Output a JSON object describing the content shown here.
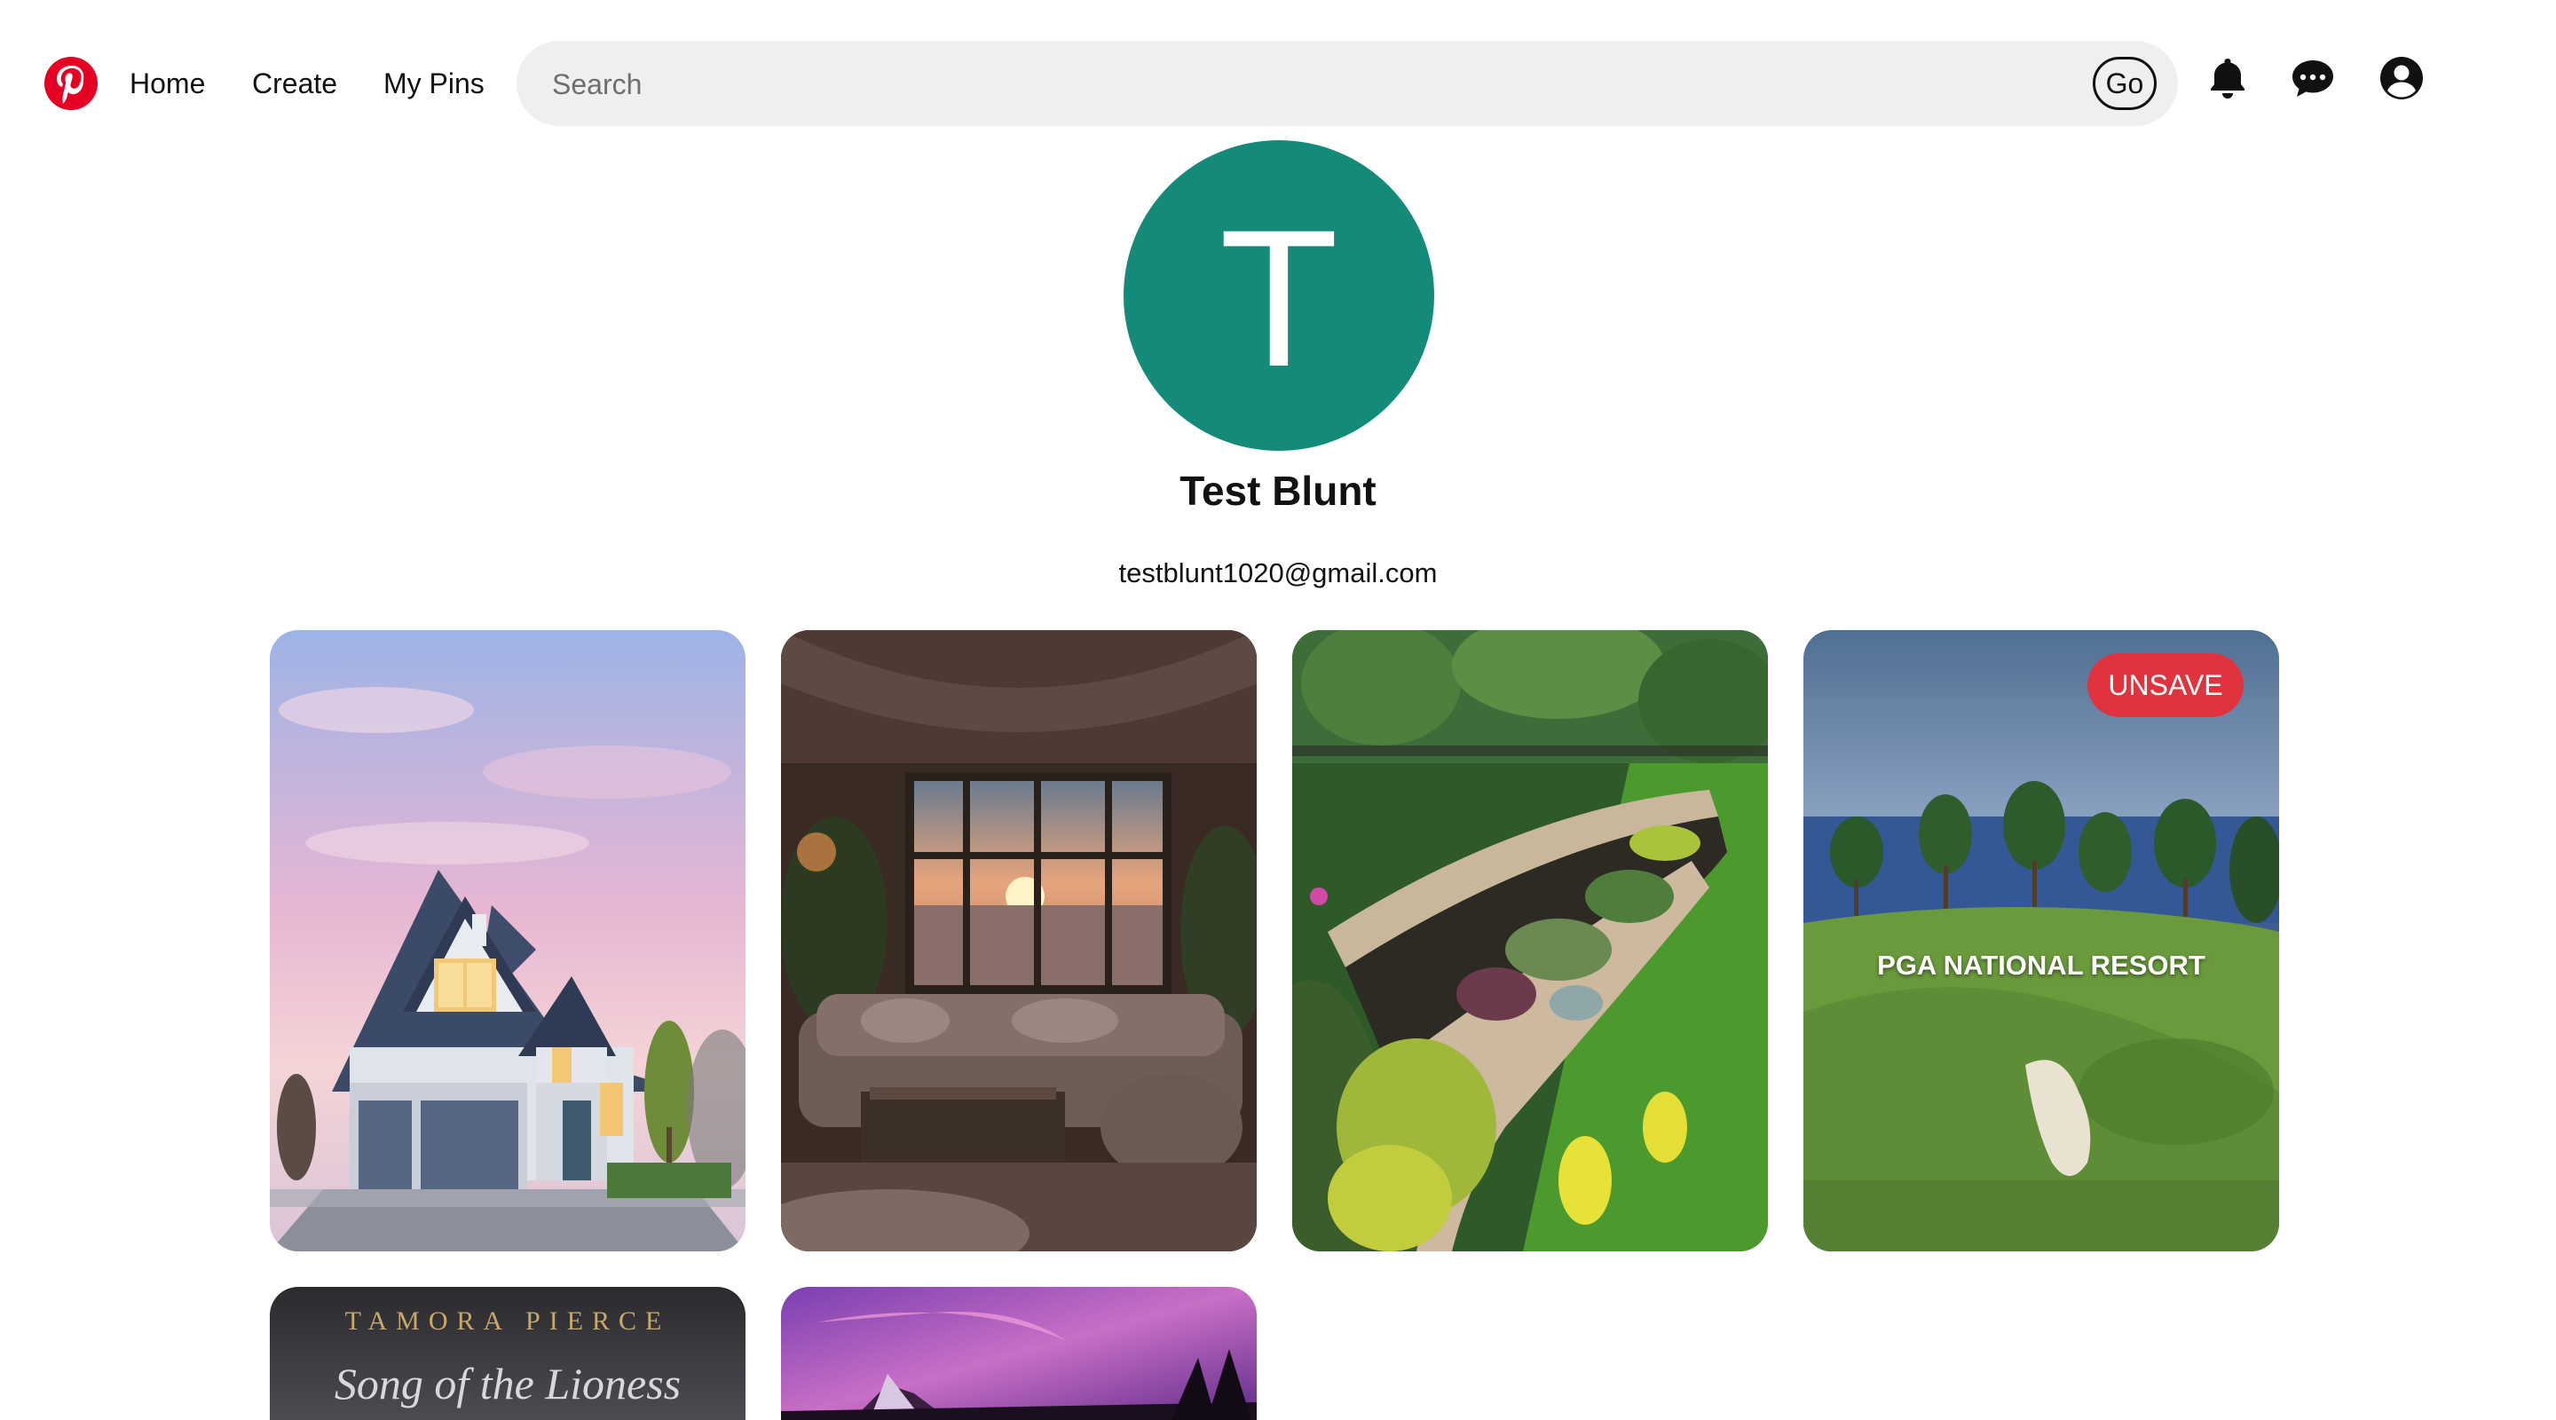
{
  "header": {
    "nav": [
      "Home",
      "Create",
      "My Pins"
    ],
    "search_placeholder": "Search",
    "go_label": "Go",
    "icons": [
      "pinterest-logo",
      "bell-icon",
      "chat-icon",
      "user-icon"
    ]
  },
  "profile": {
    "initial": "T",
    "name": "Test Blunt",
    "email": "testblunt1020@gmail.com",
    "avatar_color": "#148b79"
  },
  "pins": [
    {
      "image": "blue two-story house at sunset"
    },
    {
      "image": "cozy living room with sunset window"
    },
    {
      "image": "terraced stone garden beds"
    },
    {
      "image": "golf course by the sea",
      "caption": "PGA NATIONAL RESORT",
      "unsave_label": "UNSAVE"
    },
    {
      "image": "book cover",
      "author": "TAMORA PIERCE",
      "title": "Song of the Lioness"
    },
    {
      "image": "purple sky over mountain"
    }
  ],
  "colors": {
    "unsave": "#e0333e",
    "logo": "#e60023"
  }
}
